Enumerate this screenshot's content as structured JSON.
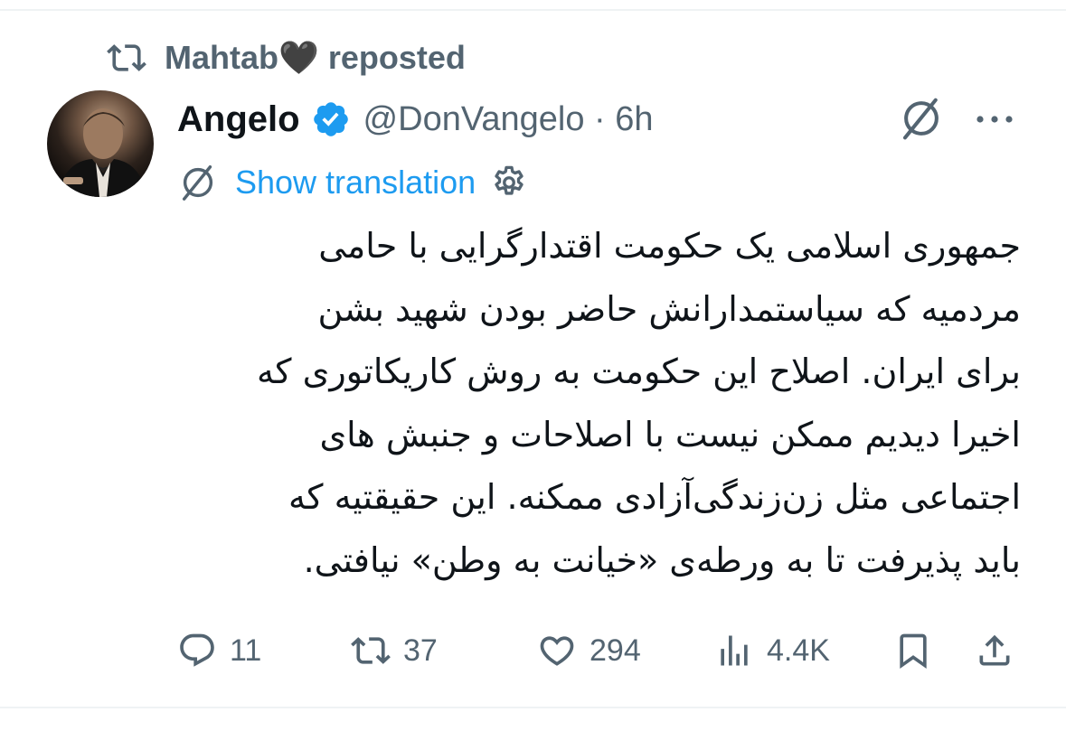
{
  "repost": {
    "label": "Mahtab🖤 reposted"
  },
  "author": {
    "name": "Angelo",
    "handle_time": "@DonVangelo · 6h",
    "verified_color": "#1d9bf0"
  },
  "translate": {
    "label": "Show translation"
  },
  "tweet": {
    "lines": [
      "جمهوری اسلامی یک حکومت اقتدارگرایی با حامی",
      "مردمیه که سیاستمدارانش حاضر بودن شهید بشن",
      "برای ایران. اصلاح این حکومت به روش کاریکاتوری که",
      "اخیرا دیدیم ممکن نیست با اصلاحات و جنبش های",
      "اجتماعی مثل زن‌زندگی‌آزادی ممکنه. این حقیقتیه که",
      "باید پذیرفت تا به ورطه‌ی «خیانت به وطن» نیافتی."
    ]
  },
  "actions": {
    "replies": "11",
    "reposts": "37",
    "likes": "294",
    "views": "4.4K"
  },
  "icons": [
    "repost-icon",
    "verified-badge-icon",
    "grok-icon",
    "more-icon",
    "grok-translate-icon",
    "gear-icon",
    "reply-icon",
    "like-icon",
    "views-icon",
    "bookmark-icon",
    "share-icon"
  ],
  "colors": {
    "secondary": "#536471",
    "link": "#1d9bf0",
    "text": "#0f1419"
  }
}
